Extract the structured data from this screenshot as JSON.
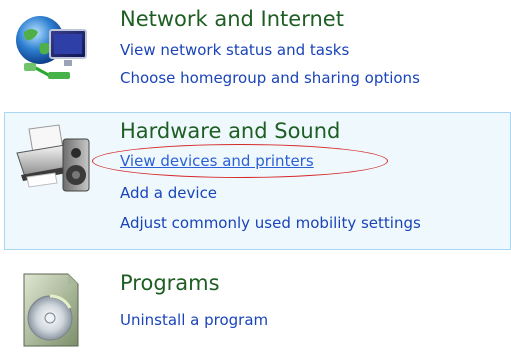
{
  "categories": {
    "network": {
      "title": "Network and Internet",
      "icon": "network-globe-icon",
      "links": [
        "View network status and tasks",
        "Choose homegroup and sharing options"
      ]
    },
    "hardware": {
      "title": "Hardware and Sound",
      "icon": "printer-speaker-icon",
      "links": [
        "View devices and printers",
        "Add a device",
        "Adjust commonly used mobility settings"
      ],
      "highlighted_link_index": 0,
      "hover_bg_color": "#eef8fd"
    },
    "programs": {
      "title": "Programs",
      "icon": "programs-disc-icon",
      "links": [
        "Uninstall a program"
      ]
    }
  },
  "colors": {
    "title": "#1e5e23",
    "link": "#1a44b8",
    "annotation": "#d62a2a"
  }
}
